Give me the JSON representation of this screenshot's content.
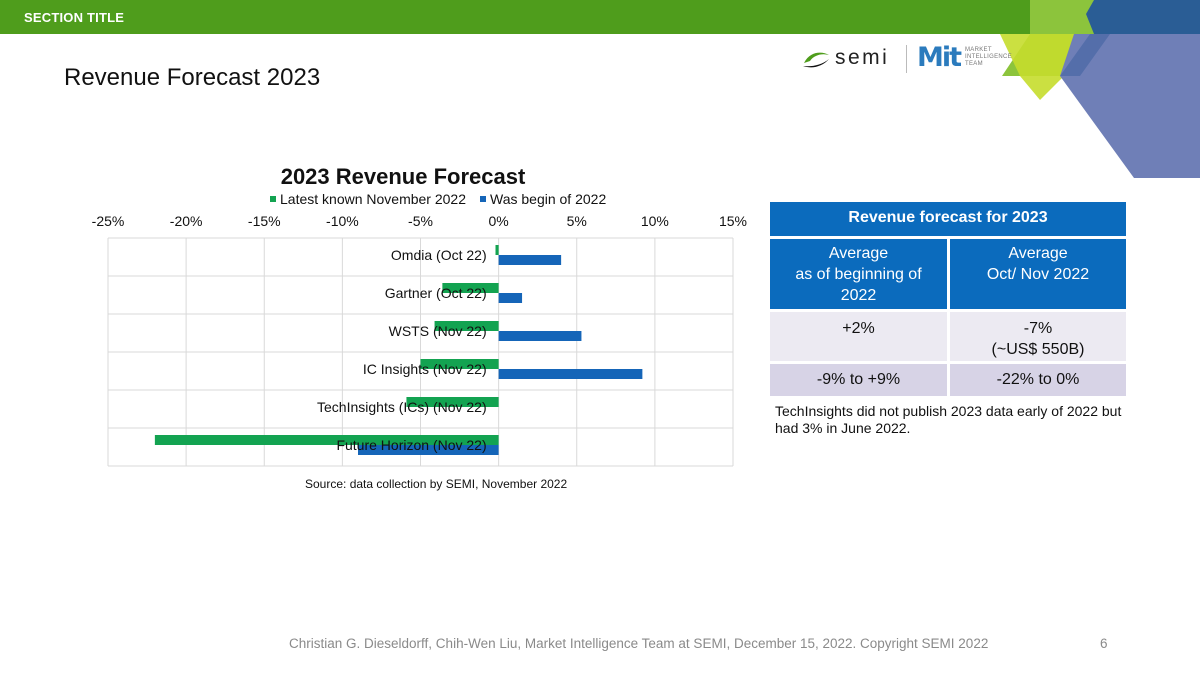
{
  "header": {
    "section_title": "SECTION TITLE",
    "colors": {
      "bar_green": "#4f9d1c",
      "deco_light_green": "#8cc43c",
      "deco_blue": "#2a5d95",
      "deco_slate": "#6f7fb7"
    }
  },
  "page": {
    "title": "Revenue Forecast 2023"
  },
  "logos": {
    "semi": "semi",
    "mit": "Mit",
    "mit_text": [
      "MARKET",
      "INTELLIGENCE",
      "TEAM"
    ]
  },
  "chart_data": {
    "type": "bar",
    "orientation": "horizontal",
    "title": "2023  Revenue Forecast",
    "categories": [
      "Omdia (Oct 22)",
      "Gartner (Oct 22)",
      "WSTS (Nov 22)",
      "IC Insights  (Nov 22)",
      "TechInsights (ICs) (Nov 22)",
      "Future Horizon (Nov 22)"
    ],
    "series": [
      {
        "name": "Latest known November 2022",
        "color": "#13a351",
        "values": [
          -0.2,
          -3.6,
          -4.1,
          -5.0,
          -5.9,
          -22.0
        ]
      },
      {
        "name": "Was begin of 2022",
        "color": "#1565b8",
        "values": [
          4.0,
          1.5,
          5.3,
          9.2,
          0,
          -9.0
        ]
      }
    ],
    "xlim": [
      -25,
      15
    ],
    "xticks": [
      "-25%",
      "-20%",
      "-15%",
      "-10%",
      "-5%",
      "0%",
      "5%",
      "10%",
      "15%"
    ],
    "legend_position": "top",
    "grid": true
  },
  "chart_source": "Source: data collection by SEMI, November 2022",
  "forecast_table": {
    "title": "Revenue forecast for 2023",
    "col1_header": [
      "Average",
      "as of beginning of",
      "2022"
    ],
    "col2_header": [
      "Average",
      "Oct/ Nov 2022"
    ],
    "row1": {
      "c1": "+2%",
      "c2": [
        "-7%",
        "(~US$ 550B)"
      ]
    },
    "row2": {
      "c1": "-9% to +9%",
      "c2": "-22% to 0%"
    },
    "note": "TechInsights did not publish 2023 data early of  2022 but had 3% in June 2022."
  },
  "footer": {
    "text": "Christian G. Dieseldorff, Chih-Wen Liu,  Market Intelligence Team at SEMI, December 15, 2022. Copyright SEMI 2022",
    "page_number": "6"
  }
}
